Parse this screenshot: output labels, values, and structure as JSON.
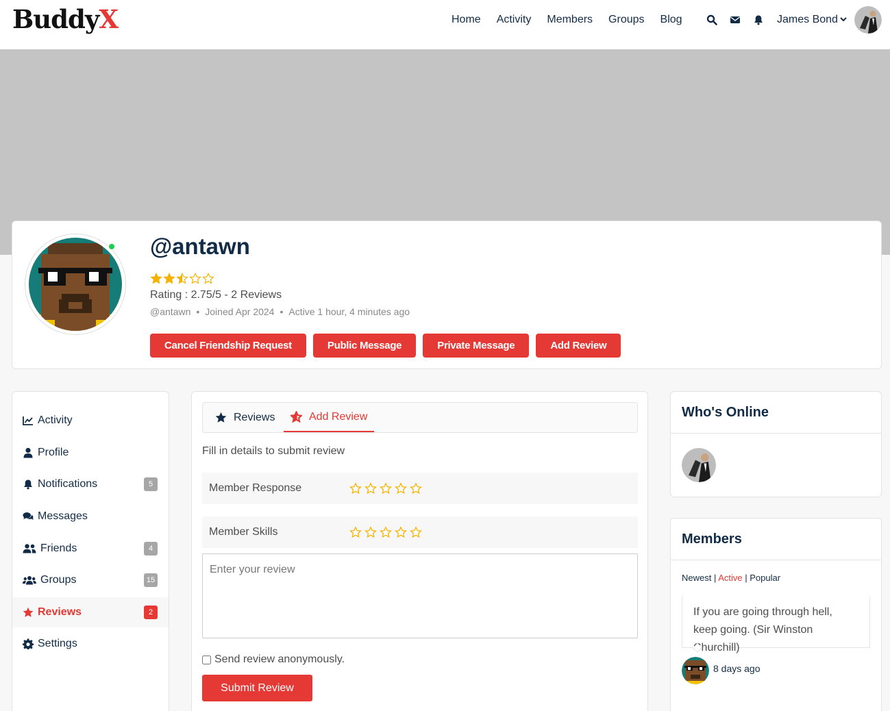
{
  "header": {
    "logo_main": "Buddy",
    "logo_accent": "X",
    "nav": [
      "Home",
      "Activity",
      "Members",
      "Groups",
      "Blog"
    ],
    "user_name": "James Bond"
  },
  "profile": {
    "username": "@antawn",
    "rating_value": 2.75,
    "rating_max": 5,
    "rating_text": "Rating : 2.75/5 - 2 Reviews",
    "handle": "@antawn",
    "joined": "Joined Apr 2024",
    "active": "Active 1 hour, 4 minutes ago",
    "actions": [
      "Cancel Friendship Request",
      "Public Message",
      "Private Message",
      "Add Review"
    ]
  },
  "sidebar": {
    "items": [
      {
        "label": "Activity",
        "icon": "activity-icon",
        "badge": ""
      },
      {
        "label": "Profile",
        "icon": "user-icon",
        "badge": ""
      },
      {
        "label": "Notifications",
        "icon": "bell-icon",
        "badge": "5"
      },
      {
        "label": "Messages",
        "icon": "messages-icon",
        "badge": ""
      },
      {
        "label": "Friends",
        "icon": "friends-icon",
        "badge": "4"
      },
      {
        "label": "Groups",
        "icon": "groups-icon",
        "badge": "15"
      },
      {
        "label": "Reviews",
        "icon": "star-icon",
        "badge": "2"
      },
      {
        "label": "Settings",
        "icon": "gear-icon",
        "badge": ""
      }
    ],
    "active": "Reviews"
  },
  "review_form": {
    "tabs": [
      "Reviews",
      "Add Review"
    ],
    "active_tab": "Add Review",
    "instructions": "Fill in details to submit review",
    "criteria": [
      "Member Response",
      "Member Skills"
    ],
    "placeholder": "Enter your review",
    "anonymous_label": "Send review anonymously.",
    "submit_label": "Submit Review"
  },
  "whos_online": {
    "title": "Who's Online"
  },
  "members_widget": {
    "title": "Members",
    "filters": [
      "Newest",
      "Active",
      "Popular"
    ],
    "active_filter": "Active",
    "quote": "If you are going through hell, keep going. (Sir Winston Churchill)",
    "time": "8 days ago"
  },
  "colors": {
    "accent": "#e53935",
    "navy": "#122b46",
    "star": "#f5b301"
  }
}
